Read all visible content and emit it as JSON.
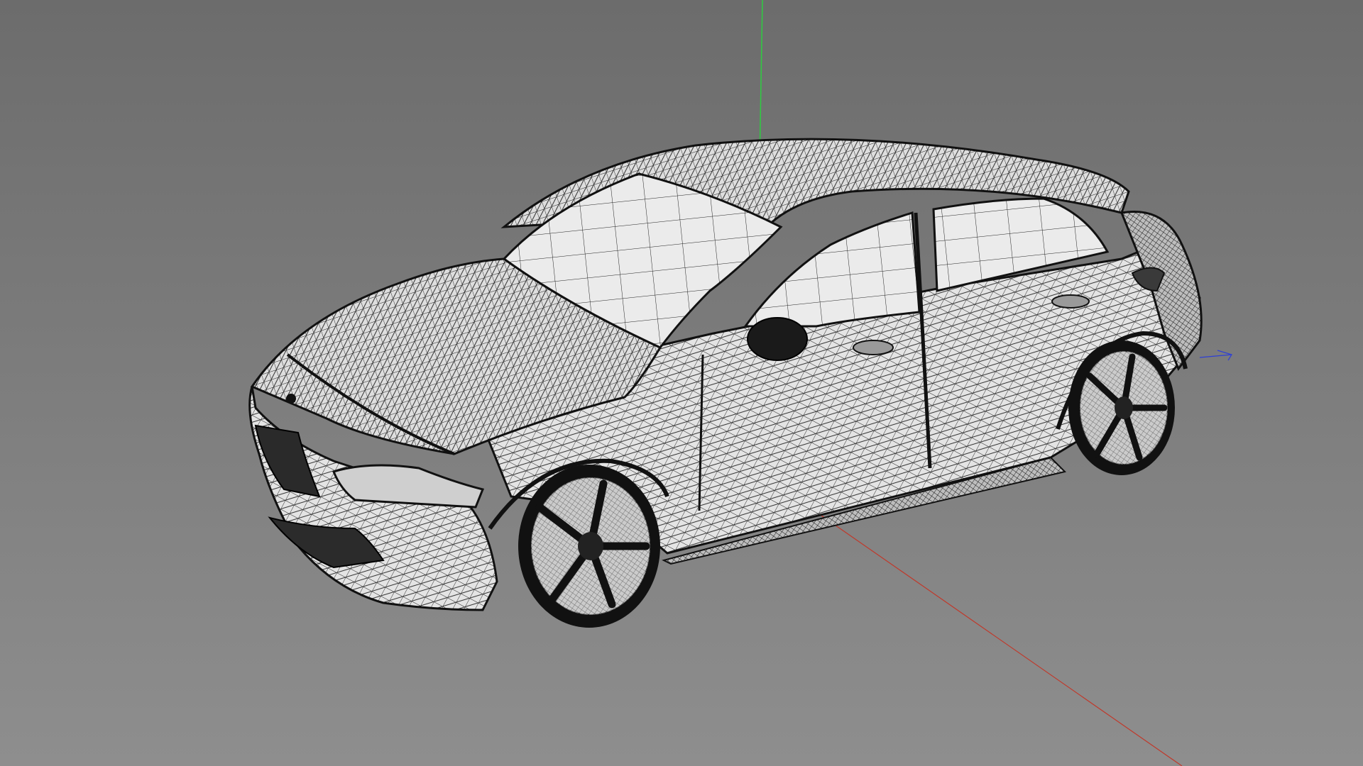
{
  "viewport": {
    "background_top": "#6c6c6c",
    "background_bottom": "#8e8e8e",
    "display_mode": "wireframe"
  },
  "axes": {
    "x_color": "#c0392b",
    "y_color": "#2ecc40",
    "z_color": "#2e3fd6"
  },
  "model": {
    "type": "car-hatchback",
    "surface_color": "#e6e6e6",
    "wire_color": "#1a1a1a"
  }
}
